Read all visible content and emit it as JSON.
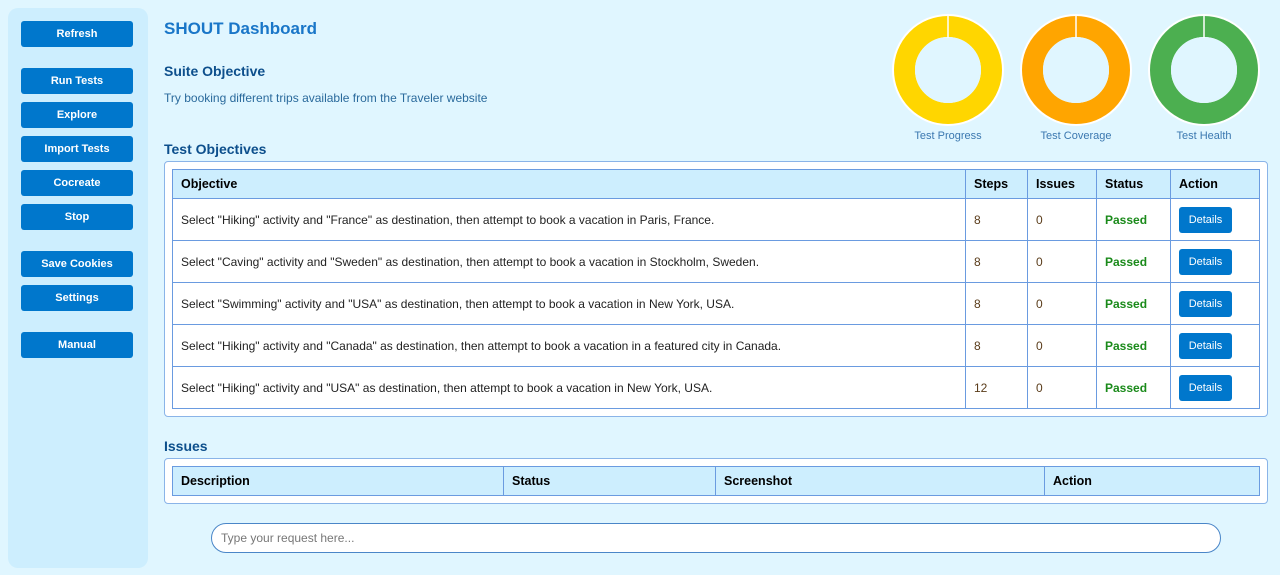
{
  "sidebar": {
    "buttons": [
      "Refresh",
      "Run Tests",
      "Explore",
      "Import Tests",
      "Cocreate",
      "Stop",
      "Save Cookies",
      "Settings",
      "Manual"
    ]
  },
  "header": {
    "title": "SHOUT Dashboard"
  },
  "suite": {
    "heading": "Suite Objective",
    "text": "Try booking different trips available from the Traveler website"
  },
  "gauges": [
    {
      "label": "Test Progress",
      "percent": 100,
      "color": "#ffd600"
    },
    {
      "label": "Test Coverage",
      "percent": 100,
      "color": "#ffa500"
    },
    {
      "label": "Test Health",
      "percent": 100,
      "color": "#4caf50"
    }
  ],
  "objectives": {
    "heading": "Test Objectives",
    "columns": [
      "Objective",
      "Steps",
      "Issues",
      "Status",
      "Action"
    ],
    "rows": [
      {
        "objective": "Select \"Hiking\" activity and \"France\" as destination, then attempt to book a vacation in Paris, France.",
        "steps": "8",
        "issues": "0",
        "status": "Passed",
        "action": "Details"
      },
      {
        "objective": "Select \"Caving\" activity and \"Sweden\" as destination, then attempt to book a vacation in Stockholm, Sweden.",
        "steps": "8",
        "issues": "0",
        "status": "Passed",
        "action": "Details"
      },
      {
        "objective": "Select \"Swimming\" activity and \"USA\" as destination, then attempt to book a vacation in New York, USA.",
        "steps": "8",
        "issues": "0",
        "status": "Passed",
        "action": "Details"
      },
      {
        "objective": "Select \"Hiking\" activity and \"Canada\" as destination, then attempt to book a vacation in a featured city in Canada.",
        "steps": "8",
        "issues": "0",
        "status": "Passed",
        "action": "Details"
      },
      {
        "objective": "Select \"Hiking\" activity and \"USA\" as destination, then attempt to book a vacation in New York, USA.",
        "steps": "12",
        "issues": "0",
        "status": "Passed",
        "action": "Details"
      }
    ]
  },
  "issues": {
    "heading": "Issues",
    "columns": [
      "Description",
      "Status",
      "Screenshot",
      "Action"
    ]
  },
  "request": {
    "placeholder": "Type your request here..."
  }
}
